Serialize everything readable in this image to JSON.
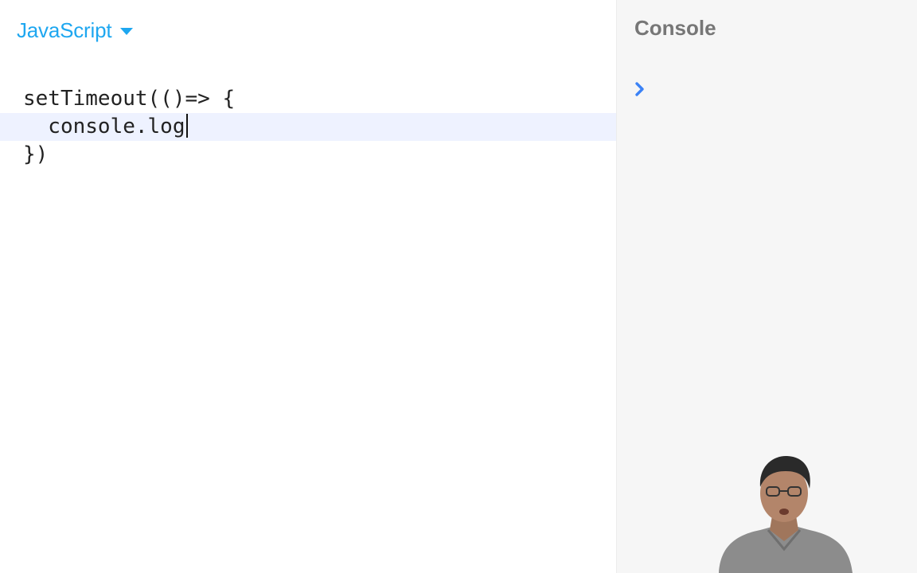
{
  "editor": {
    "language": "JavaScript",
    "code_lines": [
      "setTimeout(()=> {",
      "  console.log",
      "})"
    ],
    "active_line": 1
  },
  "console": {
    "title": "Console",
    "prompt_icon": "chevron-right-icon"
  },
  "presenter": {
    "icon": "presenter-video"
  },
  "colors": {
    "accent": "#1ea7f0",
    "prompt": "#3b82f6",
    "active_line_bg": "#eef2ff",
    "console_bg": "#f6f6f6",
    "console_title": "#777777"
  }
}
